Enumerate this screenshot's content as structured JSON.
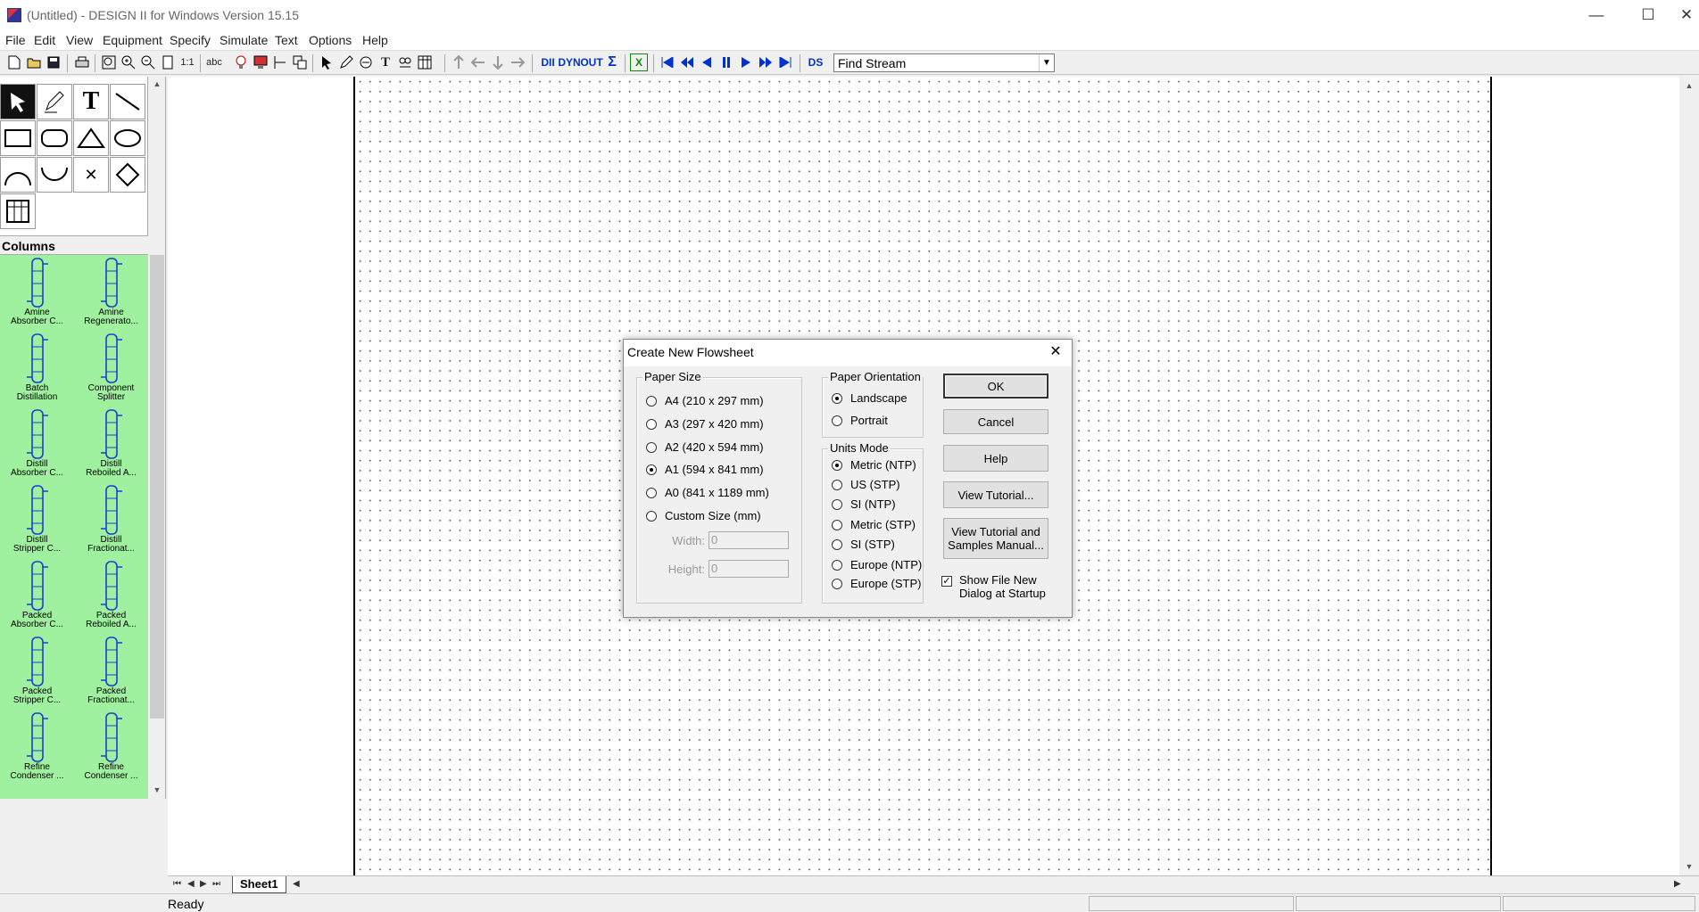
{
  "window": {
    "title": "(Untitled) - DESIGN II for Windows Version 15.15",
    "minimize": "—",
    "maximize": "☐",
    "close": "✕"
  },
  "menu": [
    "File",
    "Edit",
    "View",
    "Equipment",
    "Specify",
    "Simulate",
    "Text",
    "Options",
    "Help"
  ],
  "toolbar": {
    "find_stream_value": "Find Stream",
    "text_buttons": {
      "abc": "abc",
      "ratio": "1:1",
      "dii": "DII",
      "dyn": "DYN",
      "out": "OUT",
      "sigma": "Σ",
      "x": "X",
      "ds": "DS"
    }
  },
  "palette": {
    "tools": [
      "pointer-tool",
      "pencil-tool",
      "text-tool",
      "line-tool",
      "rectangle-tool",
      "rounded-rect-tool",
      "triangle-tool",
      "ellipse-tool",
      "arc-up-tool",
      "arc-down-tool",
      "x-tool",
      "diamond-tool",
      "table-tool"
    ],
    "text_tool_glyph": "T",
    "x_tool_glyph": "✕",
    "category": "Columns",
    "equipment": [
      {
        "line1": "Amine",
        "line2": "Absorber C..."
      },
      {
        "line1": "Amine",
        "line2": "Regenerato..."
      },
      {
        "line1": "Batch",
        "line2": "Distillation"
      },
      {
        "line1": "Component",
        "line2": "Splitter"
      },
      {
        "line1": "Distill",
        "line2": "Absorber C..."
      },
      {
        "line1": "Distill",
        "line2": "Reboiled A..."
      },
      {
        "line1": "Distill",
        "line2": "Stripper C..."
      },
      {
        "line1": "Distill",
        "line2": "Fractionat..."
      },
      {
        "line1": "Packed",
        "line2": "Absorber C..."
      },
      {
        "line1": "Packed",
        "line2": "Reboiled A..."
      },
      {
        "line1": "Packed",
        "line2": "Stripper C..."
      },
      {
        "line1": "Packed",
        "line2": "Fractionat..."
      },
      {
        "line1": "Refine",
        "line2": "Condenser ..."
      },
      {
        "line1": "Refine",
        "line2": "Condenser ..."
      }
    ]
  },
  "sheet_tabs": {
    "active": "Sheet1",
    "nav": [
      "⏮",
      "◀",
      "▶",
      "⏭"
    ]
  },
  "status": {
    "text": "Ready"
  },
  "dialog": {
    "title": "Create New Flowsheet",
    "close_glyph": "✕",
    "paper_size": {
      "label": "Paper Size",
      "options": [
        "A4 (210 x 297 mm)",
        "A3 (297 x 420 mm)",
        "A2 (420 x 594 mm)",
        "A1 (594 x 841 mm)",
        "A0 (841 x 1189 mm)",
        "Custom Size (mm)"
      ],
      "selected": "A1 (594 x 841 mm)",
      "width_label": "Width:",
      "width_value": "0",
      "height_label": "Height:",
      "height_value": "0"
    },
    "orientation": {
      "label": "Paper Orientation",
      "options": [
        "Landscape",
        "Portrait"
      ],
      "selected": "Landscape"
    },
    "units": {
      "label": "Units Mode",
      "options": [
        "Metric (NTP)",
        "US (STP)",
        "SI (NTP)",
        "Metric (STP)",
        "SI (STP)",
        "Europe (NTP)",
        "Europe (STP)"
      ],
      "selected": "Metric (NTP)"
    },
    "buttons": {
      "ok": "OK",
      "cancel": "Cancel",
      "help": "Help",
      "tutorial": "View Tutorial...",
      "samples_line1": "View Tutorial and",
      "samples_line2": "Samples Manual..."
    },
    "show_on_startup": {
      "line1": "Show File New",
      "line2": "Dialog at Startup",
      "checked": true,
      "mark": "✓"
    }
  }
}
